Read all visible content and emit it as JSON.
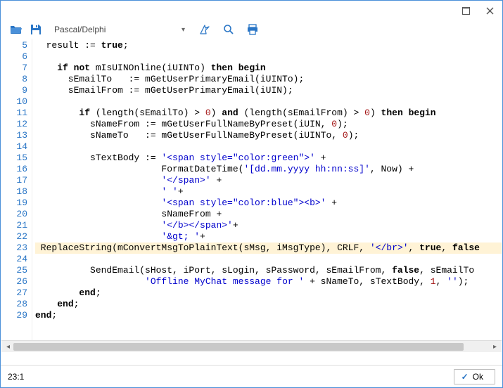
{
  "titlebar": {
    "maximize_icon": "maximize",
    "close_icon": "close"
  },
  "toolbar": {
    "open_icon": "folder-open",
    "save_icon": "save",
    "language": "Pascal/Delphi",
    "run_icon": "run",
    "search_icon": "search",
    "print_icon": "print"
  },
  "editor": {
    "first_line_number": 5,
    "highlighted_line": 23,
    "lines": [
      [
        [
          "  result := "
        ],
        [
          "kw",
          "true"
        ],
        [
          ";"
        ]
      ],
      [
        [
          ""
        ]
      ],
      [
        [
          "    "
        ],
        [
          "kw",
          "if"
        ],
        [
          " "
        ],
        [
          "kw",
          "not"
        ],
        [
          " mIsUINOnline(iUINTo) "
        ],
        [
          "kw",
          "then"
        ],
        [
          " "
        ],
        [
          "kw",
          "begin"
        ]
      ],
      [
        [
          "      sEmailTo   := mGetUserPrimaryEmail(iUINTo);"
        ]
      ],
      [
        [
          "      sEmailFrom := mGetUserPrimaryEmail(iUIN);"
        ]
      ],
      [
        [
          ""
        ]
      ],
      [
        [
          "        "
        ],
        [
          "kw",
          "if"
        ],
        [
          " (length(sEmailTo) > "
        ],
        [
          "num",
          "0"
        ],
        [
          ") "
        ],
        [
          "kw",
          "and"
        ],
        [
          " (length(sEmailFrom) > "
        ],
        [
          "num",
          "0"
        ],
        [
          ") "
        ],
        [
          "kw",
          "then"
        ],
        [
          " "
        ],
        [
          "kw",
          "begin"
        ]
      ],
      [
        [
          "          sNameFrom := mGetUserFullNameByPreset(iUIN, "
        ],
        [
          "num",
          "0"
        ],
        [
          ");"
        ]
      ],
      [
        [
          "          sNameTo   := mGetUserFullNameByPreset(iUINTo, "
        ],
        [
          "num",
          "0"
        ],
        [
          ");"
        ]
      ],
      [
        [
          ""
        ]
      ],
      [
        [
          "          sTextBody := "
        ],
        [
          "str",
          "'<span style=\"color:green\">'"
        ],
        [
          " +"
        ]
      ],
      [
        [
          "                       FormatDateTime("
        ],
        [
          "str",
          "'[dd.mm.yyyy hh:nn:ss]'"
        ],
        [
          ", Now) +"
        ]
      ],
      [
        [
          "                       "
        ],
        [
          "str",
          "'</span>'"
        ],
        [
          " +"
        ]
      ],
      [
        [
          "                       "
        ],
        [
          "str",
          "' '"
        ],
        [
          "+"
        ]
      ],
      [
        [
          "                       "
        ],
        [
          "str",
          "'<span style=\"color:blue\"><b>'"
        ],
        [
          " +"
        ]
      ],
      [
        [
          "                       sNameFrom +"
        ]
      ],
      [
        [
          "                       "
        ],
        [
          "str",
          "'</b></span>'"
        ],
        [
          "+"
        ]
      ],
      [
        [
          "                       "
        ],
        [
          "str",
          "'&gt; '"
        ],
        [
          "+"
        ]
      ],
      [
        [
          " ReplaceString(mConvertMsgToPlainText(sMsg, iMsgType), CRLF, "
        ],
        [
          "str",
          "'</br>'"
        ],
        [
          ", "
        ],
        [
          "kw",
          "true"
        ],
        [
          ", "
        ],
        [
          "kw",
          "false"
        ]
      ],
      [
        [
          ""
        ]
      ],
      [
        [
          "          SendEmail(sHost, iPort, sLogin, sPassword, sEmailFrom, "
        ],
        [
          "kw",
          "false"
        ],
        [
          ", sEmailTo"
        ]
      ],
      [
        [
          "                    "
        ],
        [
          "str",
          "'Offline MyChat message for '"
        ],
        [
          " + sNameTo, sTextBody, "
        ],
        [
          "num",
          "1"
        ],
        [
          ", "
        ],
        [
          "str",
          "''"
        ],
        [
          ");"
        ]
      ],
      [
        [
          "        "
        ],
        [
          "kw",
          "end"
        ],
        [
          ";"
        ]
      ],
      [
        [
          "    "
        ],
        [
          "kw",
          "end"
        ],
        [
          ";"
        ]
      ],
      [
        [
          "kw",
          "end"
        ],
        [
          ";"
        ]
      ]
    ]
  },
  "status": {
    "position": "23:1",
    "ok_label": "Ok"
  }
}
